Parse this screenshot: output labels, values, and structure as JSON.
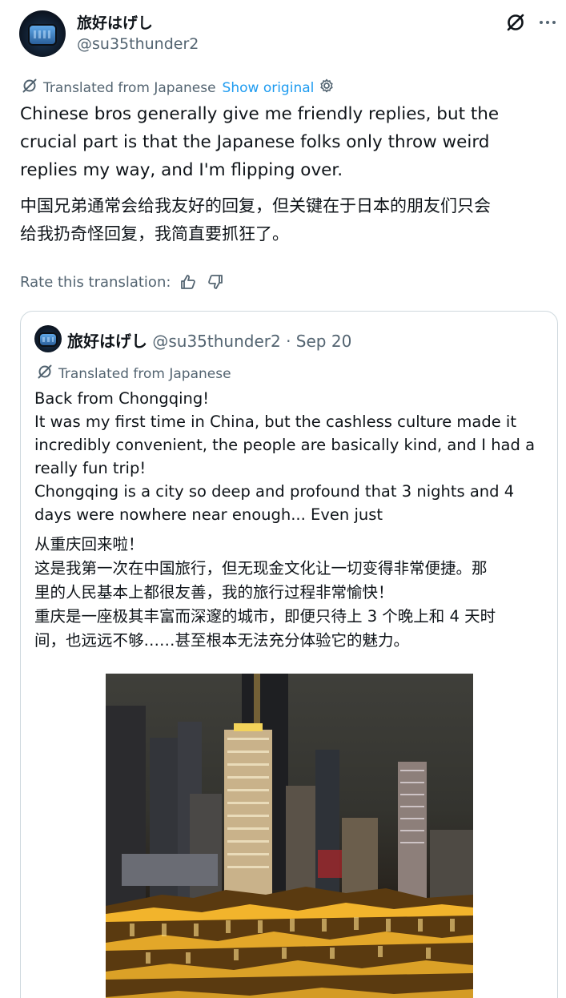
{
  "tweet": {
    "display_name": "旅好はげし",
    "handle": "@su35thunder2",
    "translated_from": "Translated from Japanese",
    "show_original": "Show original",
    "text_en": "Chinese bros generally give me friendly replies, but the\ncrucial part is that the Japanese folks only throw weird\nreplies my way, and I'm flipping over.",
    "text_zh": "中国兄弟通常会给我友好的回复，但关键在于日本的朋友们只会\n给我扔奇怪回复，我简直要抓狂了。",
    "rate_label": "Rate this translation:",
    "icons": {
      "grok": "grok-slash-icon",
      "more": "more-dots-icon",
      "translate": "translate-icon",
      "settings": "gear-icon",
      "thumbs_up": "thumbs-up-icon",
      "thumbs_down": "thumbs-down-icon"
    }
  },
  "quote": {
    "display_name": "旅好はげし",
    "meta": "@su35thunder2 · Sep 20",
    "translated_from": "Translated from Japanese",
    "text_en": "Back from Chongqing!\nIt was my first time in China, but the cashless culture made it\nincredibly convenient, the people are basically kind, and I had a\nreally fun trip!\nChongqing is a city so deep and profound that 3 nights and 4\ndays were nowhere near enough... Even just",
    "text_zh": "从重庆回来啦！\n这是我第一次在中国旅行，但无现金文化让一切变得非常便捷。那\n里的人民基本上都很友善，我的旅行过程非常愉快！\n重庆是一座极其丰富而深邃的城市，即便只待上 3 个晚上和 4 天时\n间，也远远不够……甚至根本无法充分体验它的魅力。",
    "photo": "chongqing-night-skyline-photo"
  },
  "colors": {
    "text": "#0f1419",
    "secondary": "#536471",
    "link": "#1d9bf0",
    "border": "#cfd9de"
  }
}
